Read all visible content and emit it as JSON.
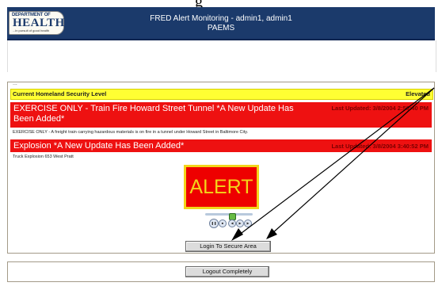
{
  "page_caption": "g",
  "header": {
    "logo": {
      "dept_text": "DEPARTMENT OF",
      "health_text": "HEALTH",
      "tagline": "...in pursuit of good health"
    },
    "title_line1": "FRED Alert Monitoring - admin1, admin1",
    "title_line2": "PAEMS"
  },
  "panel": {
    "scrap_text": "...",
    "homeland_security": {
      "label": "Current Homeland Security Level",
      "level": "Elevated",
      "color": "#ffff33"
    },
    "alerts": [
      {
        "title": "EXERCISE ONLY - Train Fire Howard Street Tunnel *A New Update Has Been Added*",
        "updated": "Last Updated: 3/8/2004 2:50:40 PM",
        "description": "EXERCISE ONLY - A freight train carrying hazardous materials is on fire in a tunnel under Howard Street in Baltimore City."
      },
      {
        "title": "Explosion *A New Update Has Been Added*",
        "updated": "Last Updated: 3/8/2004 3:40:52 PM",
        "description": "Truck Explosion 653 West Pratt"
      }
    ],
    "alert_color": "#ee1111",
    "alert_graphic_text": "ALERT",
    "player": {
      "icons": [
        "pause-icon",
        "stop-icon",
        "rewind-icon",
        "fast-forward-icon",
        "next-icon"
      ]
    },
    "login_button": "Login To Secure Area"
  },
  "bottom": {
    "logout_button": "Logout Completely"
  }
}
